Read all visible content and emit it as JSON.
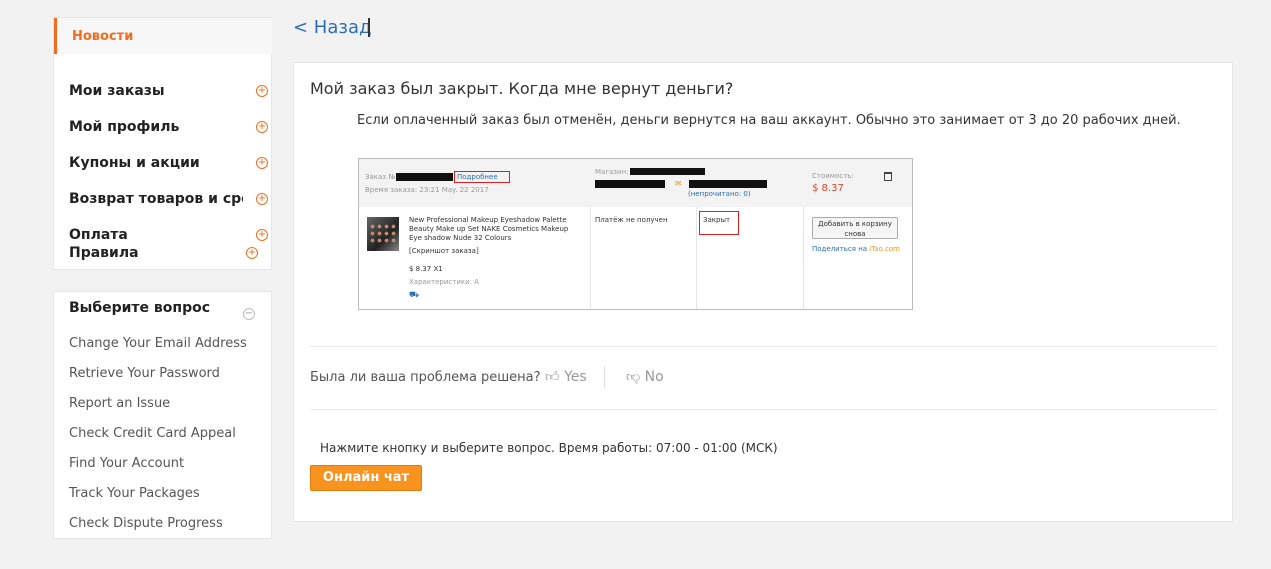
{
  "sidebar": {
    "active_item": "Новости",
    "items": [
      {
        "label": "Мои заказы"
      },
      {
        "label": "Мой профиль"
      },
      {
        "label": "Купоны и акции"
      },
      {
        "label": "Возврат товаров и средств"
      },
      {
        "label": "Оплата"
      },
      {
        "label": "Правила"
      }
    ],
    "expand_glyph": "+"
  },
  "questions": {
    "title": "Выберите вопрос",
    "collapse_glyph": "−",
    "items": [
      "Change Your Email Address",
      "Retrieve Your Password",
      "Report an Issue",
      "Check Credit Card Appeal",
      "Find Your Account",
      "Track Your Packages",
      "Check Dispute Progress"
    ]
  },
  "back_link": "< Назад",
  "article": {
    "question": "Мой заказ был закрыт. Когда мне вернут деньги?",
    "answer": "Если оплаченный заказ был отменён, деньги вернутся на ваш аккаунт. Обычно это занимает от 3 до 20 рабочих дней."
  },
  "order_screenshot": {
    "order_label": "Заказ №:",
    "details_link": "Подробнее",
    "order_time": "Время заказа: 23:21 May. 22 2017",
    "store_label": "Магазин:",
    "unread": "(непрочитано: 0)",
    "cost_label": "Стоимость:",
    "cost_value": "$ 8.37",
    "product_title": "New Professional Makeup Eyeshadow Palette Beauty Make up Set NAKE Cosmetics Makeup Eye shadow Nude 32 Colours",
    "snapshot": "[Скриншот заказа]",
    "price_qty": "$ 8.37 X1",
    "properties": "Характеристики: A",
    "payment_status": "Платёж не получен",
    "order_status": "Закрыт",
    "add_to_cart": "Добавить в корзину снова",
    "share_prefix": "Поделиться на ",
    "share_site": "iTao.com"
  },
  "feedback": {
    "question": "Была ли ваша проблема решена?",
    "yes": "Yes",
    "no": "No"
  },
  "support": {
    "hours": "Нажмите кнопку и выберите вопрос. Время работы: 07:00 - 01:00 (МСК)",
    "chat_button": "Онлайн чат"
  },
  "colors": {
    "accent": "#f26c1d",
    "link": "#2a6ebb",
    "chat_button": "#f7931e"
  }
}
